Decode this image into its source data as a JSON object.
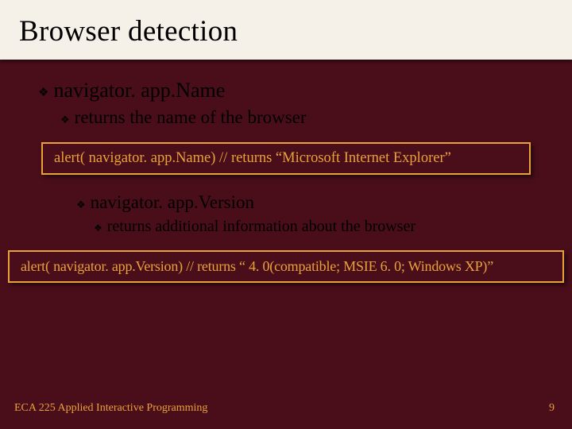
{
  "title": "Browser detection",
  "bullets": {
    "navAppName": "navigator. app.Name",
    "returnsName": "returns the name of the browser",
    "navAppVersion": "navigator. app.Version",
    "returnsInfo": "returns additional information about the browser"
  },
  "code": {
    "alert1": "alert( navigator. app.Name)   // returns “Microsoft Internet Explorer”",
    "alert2": "alert( navigator. app.Version) // returns “ 4. 0(compatible; MSIE 6. 0; Windows XP)”"
  },
  "footer": {
    "left": "ECA 225   Applied Interactive Programming",
    "right": "9"
  }
}
